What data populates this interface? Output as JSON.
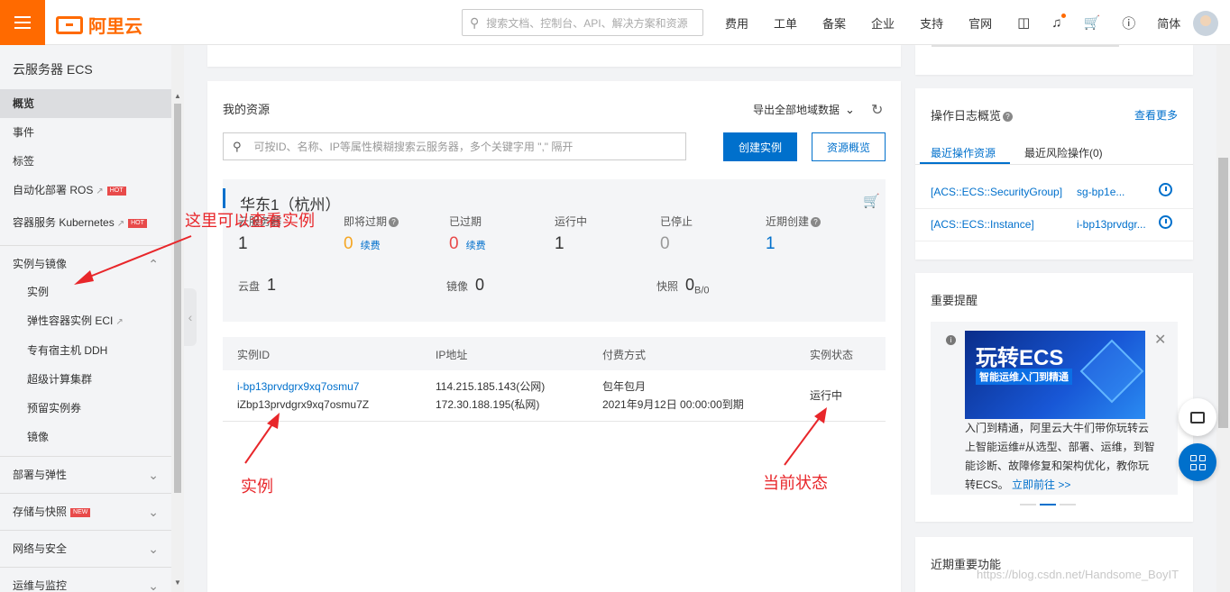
{
  "topbar": {
    "logo_text": "阿里云",
    "search_placeholder": "搜索文档、控制台、API、解决方案和资源",
    "nav": [
      "费用",
      "工单",
      "备案",
      "企业",
      "支持",
      "官网"
    ],
    "lang": "简体"
  },
  "sidebar": {
    "title": "云服务器 ECS",
    "items": [
      {
        "label": "概览"
      },
      {
        "label": "事件"
      },
      {
        "label": "标签"
      },
      {
        "label": "自动化部署 ROS",
        "badge": "HOT"
      },
      {
        "label": "容器服务 Kubernetes",
        "badge": "HOT"
      }
    ],
    "group_label": "实例与镜像",
    "sub_items": [
      "实例",
      "弹性容器实例 ECI",
      "专有宿主机 DDH",
      "超级计算集群",
      "预留实例券",
      "镜像"
    ],
    "sections": [
      {
        "label": "部署与弹性"
      },
      {
        "label": "存储与快照",
        "badge": "NEW"
      },
      {
        "label": "网络与安全"
      },
      {
        "label": "运维与监控"
      }
    ]
  },
  "resources": {
    "title": "我的资源",
    "export": "导出全部地域数据",
    "search_placeholder": "可按ID、名称、IP等属性模糊搜索云服务器，多个关键字用 \",\" 隔开",
    "create_btn": "创建实例",
    "overview_btn": "资源概览",
    "region": "华东1（杭州）",
    "stats": [
      {
        "label": "云服务器",
        "value": "1"
      },
      {
        "label": "即将过期",
        "value": "0",
        "action": "续费"
      },
      {
        "label": "已过期",
        "value": "0",
        "action": "续费"
      },
      {
        "label": "运行中",
        "value": "1"
      },
      {
        "label": "已停止",
        "value": "0"
      },
      {
        "label": "近期创建",
        "value": "1"
      }
    ],
    "disk": {
      "label": "云盘",
      "value": "1"
    },
    "image": {
      "label": "镜像",
      "value": "0"
    },
    "snapshot": {
      "label": "快照",
      "value": "0",
      "unit": "B/0"
    },
    "table": {
      "headers": [
        "实例ID",
        "IP地址",
        "付费方式",
        "实例状态"
      ],
      "rows": [
        {
          "id": "i-bp13prvdgrx9xq7osmu7",
          "name": "iZbp13prvdgrx9xq7osmu7Z",
          "ip_public": "114.215.185.143(公网)",
          "ip_private": "172.30.188.195(私网)",
          "pay": "包年包月",
          "expire": "2021年9月12日 00:00:00到期",
          "status": "运行中"
        }
      ]
    }
  },
  "oplog": {
    "title": "操作日志概览",
    "more": "查看更多",
    "tabs": [
      "最近操作资源",
      "最近风险操作(0)"
    ],
    "rows": [
      {
        "type": "[ACS::ECS::SecurityGroup]",
        "id": "sg-bp1e..."
      },
      {
        "type": "[ACS::ECS::Instance]",
        "id": "i-bp13prvdgr..."
      }
    ]
  },
  "reminder": {
    "title": "重要提醒",
    "banner_title": "玩转ECS",
    "banner_sub": "智能运维入门到精通",
    "text": "入门到精通，阿里云大牛们带你玩转云上智能运维#从选型、部署、运维，到智能诊断、故障修复和架构优化，教你玩转ECS。",
    "link": "立即前往 >>"
  },
  "recent": {
    "title": "近期重要功能"
  },
  "annotations": {
    "view_instance": "这里可以查看实例",
    "instance": "实例",
    "status": "当前状态",
    "arrow_color": "#e8262a"
  },
  "watermark": "https://blog.csdn.net/Handsome_BoyIT",
  "colors": {
    "brand": "#ff6a00",
    "primary": "#0070cc"
  }
}
